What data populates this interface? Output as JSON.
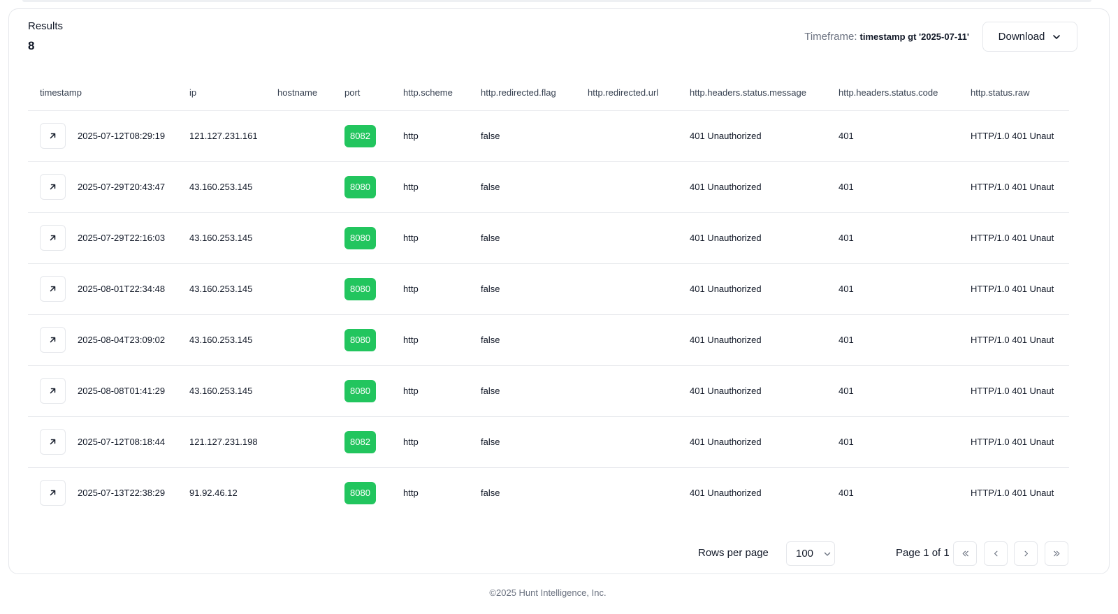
{
  "results": {
    "label": "Results",
    "count": "8"
  },
  "timeframe": {
    "label": "Timeframe:",
    "value": "timestamp gt '2025-07-11'"
  },
  "download": {
    "label": "Download",
    "icon": "chevron-down-icon"
  },
  "columns": [
    "timestamp",
    "ip",
    "hostname",
    "port",
    "http.scheme",
    "http.redirected.flag",
    "http.redirected.url",
    "http.headers.status.message",
    "http.headers.status.code",
    "http.status.raw"
  ],
  "rows": [
    {
      "timestamp": "2025-07-12T08:29:19",
      "ip": "121.127.231.161",
      "hostname": "",
      "port": "8082",
      "scheme": "http",
      "redirected_flag": "false",
      "redirected_url": "",
      "status_message": "401 Unauthorized",
      "status_code": "401",
      "status_raw": "HTTP/1.0 401 Unaut"
    },
    {
      "timestamp": "2025-07-29T20:43:47",
      "ip": "43.160.253.145",
      "hostname": "",
      "port": "8080",
      "scheme": "http",
      "redirected_flag": "false",
      "redirected_url": "",
      "status_message": "401 Unauthorized",
      "status_code": "401",
      "status_raw": "HTTP/1.0 401 Unaut"
    },
    {
      "timestamp": "2025-07-29T22:16:03",
      "ip": "43.160.253.145",
      "hostname": "",
      "port": "8080",
      "scheme": "http",
      "redirected_flag": "false",
      "redirected_url": "",
      "status_message": "401 Unauthorized",
      "status_code": "401",
      "status_raw": "HTTP/1.0 401 Unaut"
    },
    {
      "timestamp": "2025-08-01T22:34:48",
      "ip": "43.160.253.145",
      "hostname": "",
      "port": "8080",
      "scheme": "http",
      "redirected_flag": "false",
      "redirected_url": "",
      "status_message": "401 Unauthorized",
      "status_code": "401",
      "status_raw": "HTTP/1.0 401 Unaut"
    },
    {
      "timestamp": "2025-08-04T23:09:02",
      "ip": "43.160.253.145",
      "hostname": "",
      "port": "8080",
      "scheme": "http",
      "redirected_flag": "false",
      "redirected_url": "",
      "status_message": "401 Unauthorized",
      "status_code": "401",
      "status_raw": "HTTP/1.0 401 Unaut"
    },
    {
      "timestamp": "2025-08-08T01:41:29",
      "ip": "43.160.253.145",
      "hostname": "",
      "port": "8080",
      "scheme": "http",
      "redirected_flag": "false",
      "redirected_url": "",
      "status_message": "401 Unauthorized",
      "status_code": "401",
      "status_raw": "HTTP/1.0 401 Unaut"
    },
    {
      "timestamp": "2025-07-12T08:18:44",
      "ip": "121.127.231.198",
      "hostname": "",
      "port": "8082",
      "scheme": "http",
      "redirected_flag": "false",
      "redirected_url": "",
      "status_message": "401 Unauthorized",
      "status_code": "401",
      "status_raw": "HTTP/1.0 401 Unaut"
    },
    {
      "timestamp": "2025-07-13T22:38:29",
      "ip": "91.92.46.12",
      "hostname": "",
      "port": "8080",
      "scheme": "http",
      "redirected_flag": "false",
      "redirected_url": "",
      "status_message": "401 Unauthorized",
      "status_code": "401",
      "status_raw": "HTTP/1.0 401 Unaut"
    }
  ],
  "pagination": {
    "rows_per_page_label": "Rows per page",
    "rows_per_page_value": "100",
    "page_info": "Page 1 of 1"
  },
  "colors": {
    "port_badge": "#22c55e",
    "border": "#e5e7eb"
  },
  "footer": {
    "text": "©2025 Hunt Intelligence, Inc."
  }
}
